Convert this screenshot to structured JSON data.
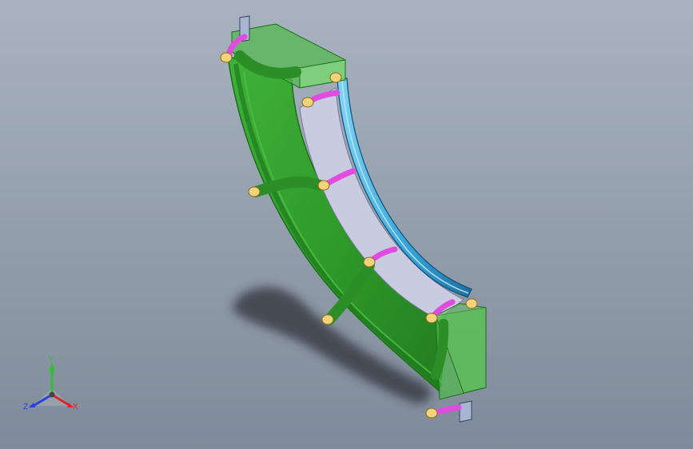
{
  "viewport": {
    "background_top": "#a9b3c0",
    "background_bottom": "#7f8b9a"
  },
  "model": {
    "body_color": "#2f9b2a",
    "body_edge_color": "#1d6f1a",
    "inner_face_color": "#c9cbe0",
    "rail_color": "#3aa6d9",
    "pin_color": "#e04ce0",
    "bearing_color": "#f2d27a",
    "shadow_color": "#2e333a"
  },
  "triad": {
    "y_label": "Y",
    "x_label": "X",
    "z_label": "Z",
    "y_color": "#2ec22e",
    "x_color": "#e02424",
    "z_color": "#2a3fe0"
  }
}
